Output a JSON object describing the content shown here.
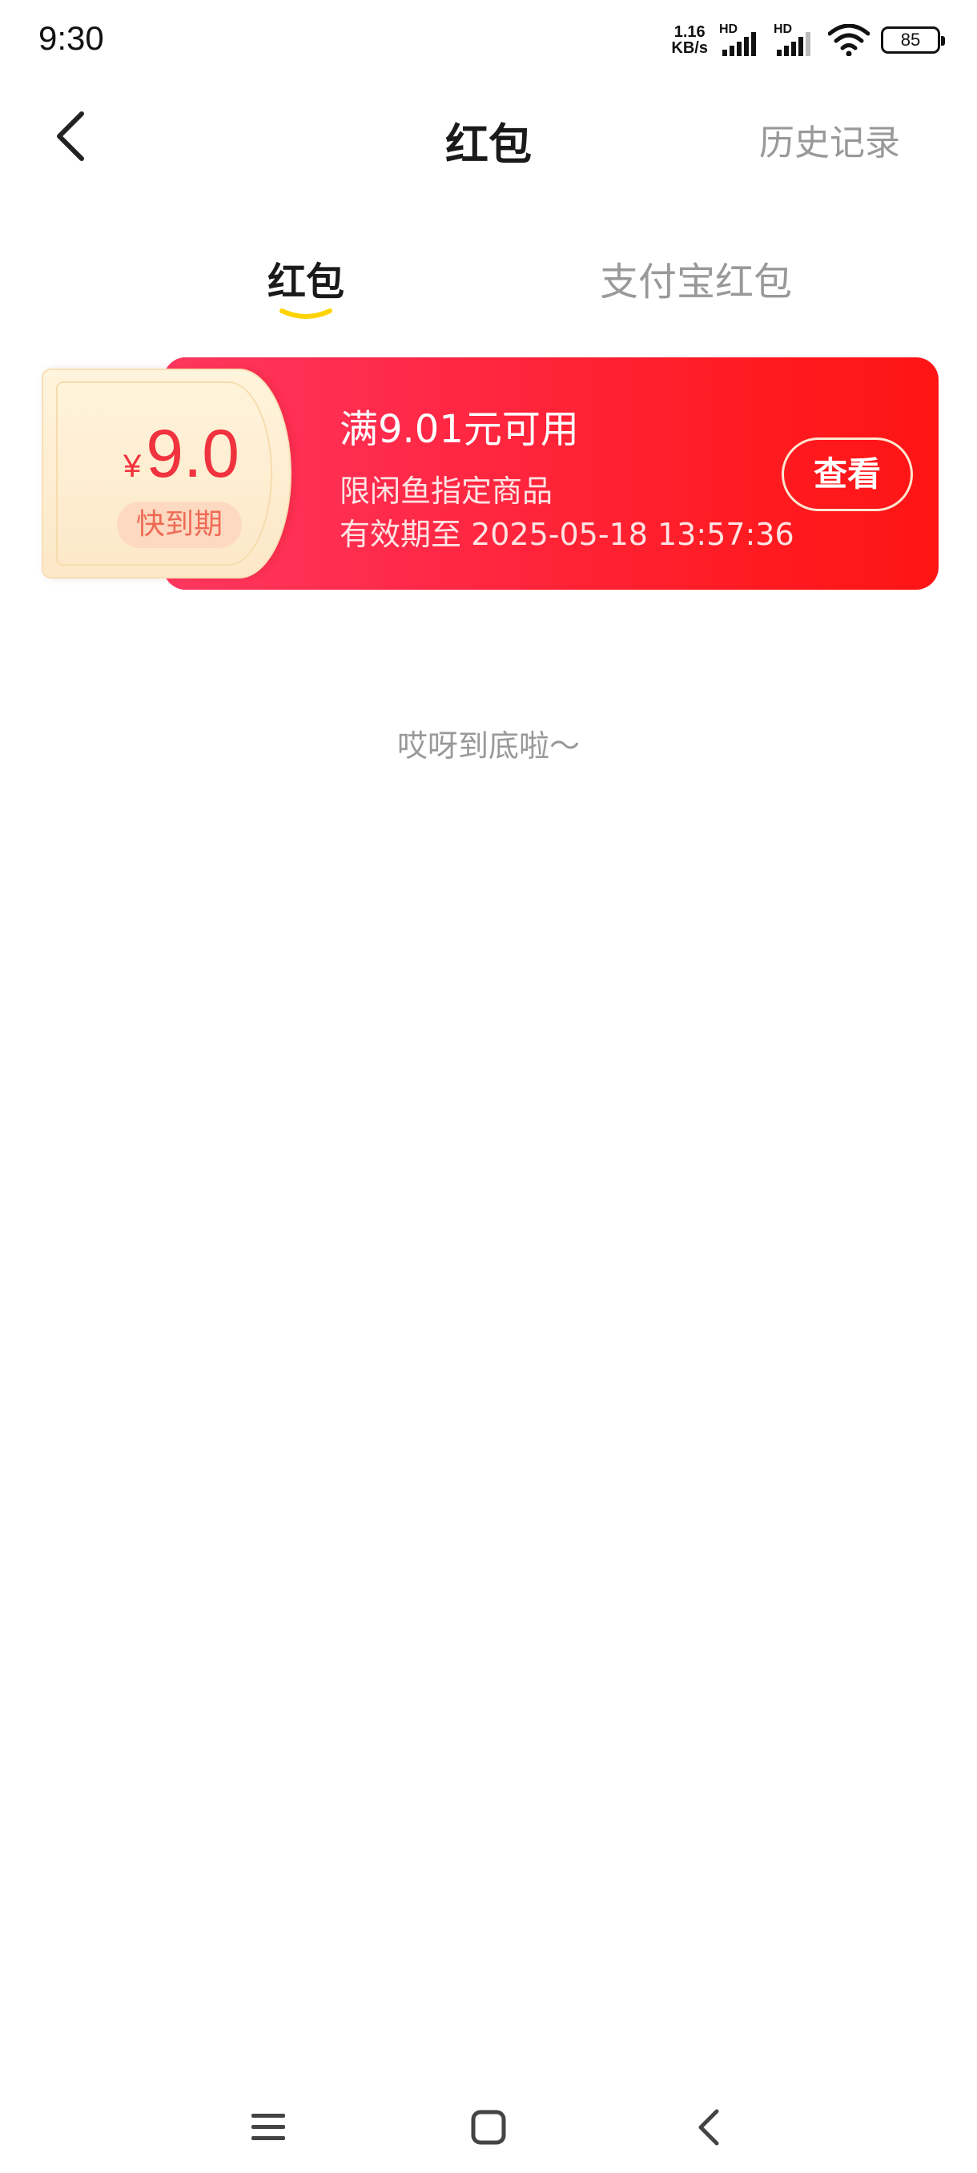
{
  "status_bar": {
    "time": "9:30",
    "net_speed_value": "1.16",
    "net_speed_unit": "KB/s",
    "signal_1_label": "HD",
    "signal_2_label": "HD",
    "battery_level": "85",
    "icons": [
      "signal-icon",
      "wifi-icon",
      "battery-icon"
    ]
  },
  "header": {
    "title": "红包",
    "history_label": "历史记录",
    "back_icon": "chevron-left-icon"
  },
  "tabs": [
    {
      "label": "红包",
      "active": true
    },
    {
      "label": "支付宝红包",
      "active": false
    }
  ],
  "coupons": [
    {
      "currency_symbol": "¥",
      "amount": "9.0",
      "badge": "快到期",
      "title": "满9.01元可用",
      "scope": "限闲鱼指定商品",
      "validity": "有效期至 2025-05-18 13:57:36",
      "action_label": "查看"
    }
  ],
  "end_message": "哎呀到底啦～",
  "nav_bar": {
    "icons": [
      "menu-icon",
      "home-icon",
      "back-icon"
    ]
  },
  "colors": {
    "accent_red": "#ff1b22",
    "tab_indicator": "#ffd400",
    "coupon_amount": "#f0333e"
  }
}
